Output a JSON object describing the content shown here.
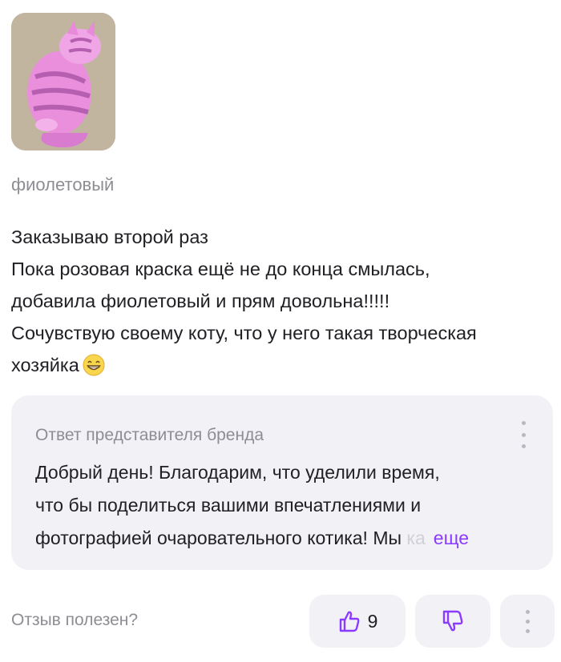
{
  "review": {
    "photo_icon": "pink-cat-photo",
    "variant": "фиолетовый",
    "lines": [
      "Заказываю второй раз",
      "Пока розовая краска ещё не до конца смылась,",
      "добавила фиолетовый и прям довольна!!!!!",
      "Сочувствую своему коту, что у него такая творческая",
      "хозяйка"
    ],
    "emoji": "grinning-face-emoji"
  },
  "brand_reply": {
    "title": "Ответ представителя бренда",
    "lines": [
      "Добрый день! Благодарим, что уделили время,",
      "что бы поделиться вашими впечатлениями и",
      "фотографией очаровательного котика! Мы"
    ],
    "faded_text": "ка",
    "more_label": "еще"
  },
  "footer": {
    "helpful_label": "Отзыв полезен?",
    "like_count": "9",
    "like_icon": "thumbs-up-icon",
    "dislike_icon": "thumbs-down-icon",
    "menu_icon": "vertical-dots-icon"
  },
  "colors": {
    "accent": "#8b3bff",
    "card_bg": "#f2f1f5",
    "muted_text": "#8d8d94"
  }
}
